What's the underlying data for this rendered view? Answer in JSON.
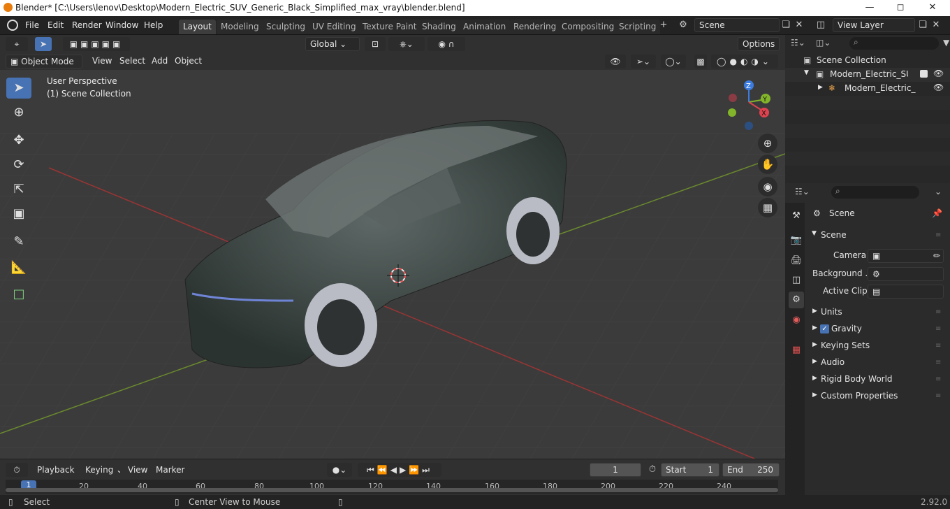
{
  "window": {
    "title": "Blender* [C:\\Users\\lenov\\Desktop\\Modern_Electric_SUV_Generic_Black_Simplified_max_vray\\blender.blend]",
    "min_icon": "minimize-icon",
    "max_icon": "maximize-icon",
    "close_icon": "close-icon"
  },
  "menus": [
    "File",
    "Edit",
    "Render",
    "Window",
    "Help"
  ],
  "workspaces": [
    "Layout",
    "Modeling",
    "Sculpting",
    "UV Editing",
    "Texture Paint",
    "Shading",
    "Animation",
    "Rendering",
    "Compositing",
    "Scripting"
  ],
  "scene_name": "Scene",
  "view_layer": "View Layer",
  "viewport": {
    "transform_orientation": "Global",
    "options": "Options",
    "mode": "Object Mode",
    "header_menus": [
      "View",
      "Select",
      "Add",
      "Object"
    ],
    "overlay_line1": "User Perspective",
    "overlay_line2": "(1) Scene Collection",
    "gizmo": {
      "z": "Z",
      "y": "Y",
      "x": "X"
    }
  },
  "outliner": {
    "root": "Scene Collection",
    "collection": "Modern_Electric_SUV_Ge",
    "object": "Modern_Electric_SUV"
  },
  "properties": {
    "context": "Scene",
    "panel": "Scene",
    "camera_label": "Camera",
    "background_label": "Background ...",
    "active_clip_label": "Active Clip",
    "subpanels": [
      "Units",
      "Gravity",
      "Keying Sets",
      "Audio",
      "Rigid Body World",
      "Custom Properties"
    ],
    "gravity_checked": true
  },
  "timeline": {
    "menus": [
      "Playback",
      "Keying",
      "View",
      "Marker"
    ],
    "current_frame": "1",
    "start_label": "Start",
    "start_value": "1",
    "end_label": "End",
    "end_value": "250",
    "ruler": [
      "1",
      "20",
      "40",
      "60",
      "80",
      "100",
      "120",
      "140",
      "160",
      "180",
      "200",
      "220",
      "240"
    ]
  },
  "status": {
    "left": "Select",
    "middle": "Center View to Mouse",
    "version": "2.92.0"
  }
}
